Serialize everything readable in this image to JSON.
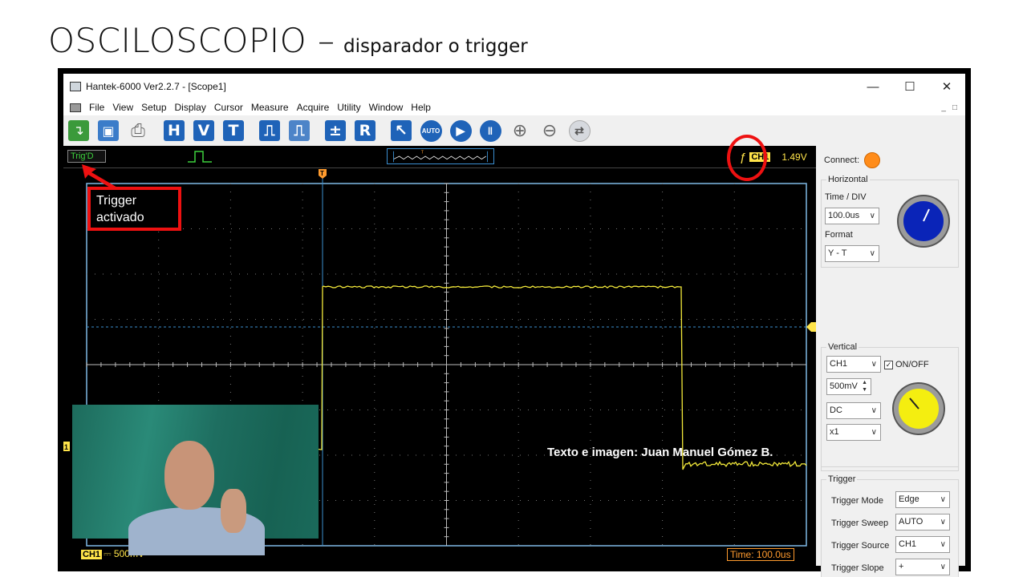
{
  "slide": {
    "title_main": "OSCILOSCOPIO –",
    "title_sub": "disparador o trigger",
    "credit": "Texto e imagen: Juan Manuel Gómez B.",
    "annotation_text": "Trigger activado"
  },
  "window": {
    "title": "Hantek-6000 Ver2.2.7 - [Scope1]",
    "controls": [
      "—",
      "☐",
      "✕"
    ]
  },
  "menu": {
    "items": [
      "File",
      "View",
      "Setup",
      "Display",
      "Cursor",
      "Measure",
      "Acquire",
      "Utility",
      "Window",
      "Help"
    ]
  },
  "toolbar": {
    "buttons": [
      {
        "name": "open-icon",
        "label": "↴"
      },
      {
        "name": "save-icon",
        "label": "▣"
      },
      {
        "name": "print-icon",
        "label": "⎙"
      },
      {
        "name": "horizontal-button",
        "label": "H"
      },
      {
        "name": "vertical-button",
        "label": "V"
      },
      {
        "name": "trigger-button",
        "label": "T"
      },
      {
        "name": "pulse-button",
        "label": "⎍"
      },
      {
        "name": "pulse-alt-button",
        "label": "⎍"
      },
      {
        "name": "math-button",
        "label": "±"
      },
      {
        "name": "reference-button",
        "label": "R"
      },
      {
        "name": "cursor-button",
        "label": "↖"
      },
      {
        "name": "auto-button",
        "label": "AUTO"
      },
      {
        "name": "run-button",
        "label": "▶"
      },
      {
        "name": "pause-button",
        "label": "‖"
      },
      {
        "name": "zoom-in-icon",
        "label": "⊕"
      },
      {
        "name": "zoom-out-icon",
        "label": "⊖"
      },
      {
        "name": "swap-icon",
        "label": "⇄"
      }
    ]
  },
  "status": {
    "trig_state": "Trig'D",
    "trig_channel": "CH1",
    "trig_level": "1.49V",
    "trig_slope_symbol": "ƒ"
  },
  "scope": {
    "channel_label": "CH1",
    "channel_scale": "⎓ 500mV",
    "time_label": "Time: 100.0us",
    "trigger_marker": "T",
    "channel_marker": "1",
    "colors": {
      "grid": "#aaaaaa",
      "trace": "#f3e93a",
      "trigger_line": "#3b8fd0",
      "border": "#7fb9e6"
    }
  },
  "panel": {
    "connect_label": "Connect:",
    "horizontal": {
      "title": "Horizontal",
      "time_div_label": "Time / DIV",
      "time_div_value": "100.0us",
      "format_label": "Format",
      "format_value": "Y - T"
    },
    "vertical": {
      "title": "Vertical",
      "channel_value": "CH1",
      "onoff_label": "ON/OFF",
      "volts_value": "500mV",
      "coupling_value": "DC",
      "probe_value": "x1"
    },
    "trigger": {
      "title": "Trigger",
      "mode_label": "Trigger Mode",
      "mode_value": "Edge",
      "sweep_label": "Trigger Sweep",
      "sweep_value": "AUTO",
      "source_label": "Trigger Source",
      "source_value": "CH1",
      "slope_label": "Trigger Slope",
      "slope_value": "+"
    }
  }
}
